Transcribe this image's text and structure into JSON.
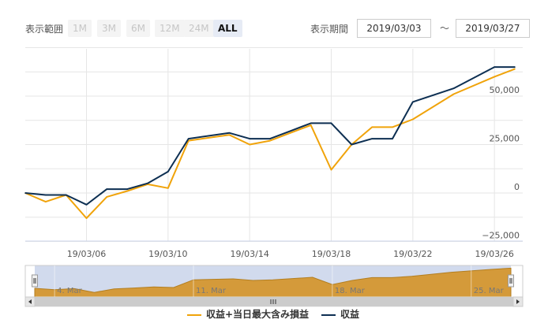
{
  "toolbar": {
    "range_label": "表示範囲",
    "range_buttons": [
      "1M",
      "3M",
      "6M",
      "12M",
      "24M",
      "ALL"
    ],
    "active_range": "ALL",
    "period_label": "表示期間",
    "date_from": "2019/03/03",
    "tilde": "～",
    "date_to": "2019/03/27"
  },
  "colors": {
    "series_a": "#f0a30a",
    "series_b": "#0d2f52",
    "navigator_fill": "#d49a3a",
    "navigator_selection": "#ccd6eb"
  },
  "chart_data": {
    "type": "line",
    "x": [
      "2019-03-03",
      "2019-03-04",
      "2019-03-05",
      "2019-03-06",
      "2019-03-07",
      "2019-03-08",
      "2019-03-09",
      "2019-03-10",
      "2019-03-11",
      "2019-03-12",
      "2019-03-13",
      "2019-03-14",
      "2019-03-15",
      "2019-03-16",
      "2019-03-17",
      "2019-03-18",
      "2019-03-19",
      "2019-03-20",
      "2019-03-21",
      "2019-03-22",
      "2019-03-23",
      "2019-03-24",
      "2019-03-25",
      "2019-03-26",
      "2019-03-27"
    ],
    "series": [
      {
        "name": "収益+当日最大含み損益",
        "color": "#f0a30a",
        "values": [
          0,
          -4500,
          -1000,
          -13000,
          -2000,
          1000,
          4500,
          2500,
          27000,
          30000,
          25000,
          27000,
          31000,
          35000,
          12000,
          25000,
          34000,
          34000,
          38000,
          51000,
          60000,
          64000
        ]
      },
      {
        "name": "収益",
        "color": "#0d2f52",
        "values": [
          0,
          -1000,
          -1000,
          -6000,
          2000,
          2000,
          5000,
          11000,
          28000,
          31000,
          28000,
          28000,
          32000,
          36000,
          36000,
          25000,
          28000,
          28000,
          47000,
          54000,
          65000,
          65000
        ]
      }
    ],
    "series_dates": [
      "2019-03-03",
      "2019-03-04",
      "2019-03-05",
      "2019-03-06",
      "2019-03-07",
      "2019-03-08",
      "2019-03-09",
      "2019-03-10",
      "2019-03-11",
      "2019-03-13",
      "2019-03-14",
      "2019-03-15",
      "2019-03-16",
      "2019-03-17",
      "2019-03-18",
      "2019-03-19",
      "2019-03-20",
      "2019-03-21",
      "2019-03-22",
      "2019-03-24",
      "2019-03-26",
      "2019-03-27"
    ],
    "x_tick_labels": [
      "19/03/06",
      "19/03/10",
      "19/03/14",
      "19/03/18",
      "19/03/22",
      "19/03/26"
    ],
    "y_tick_labels": [
      "−25,000",
      "0",
      "25,000",
      "50,000"
    ],
    "y_ticks": [
      -25000,
      0,
      25000,
      50000
    ],
    "ylim": [
      -25000,
      75000
    ],
    "grid": true,
    "legend_position": "bottom-center",
    "navigator_labels": [
      "4. Mar",
      "11. Mar",
      "18. Mar",
      "25. Mar"
    ],
    "navigator_dates": [
      "2019-03-04",
      "2019-03-11",
      "2019-03-18",
      "2019-03-25"
    ]
  }
}
